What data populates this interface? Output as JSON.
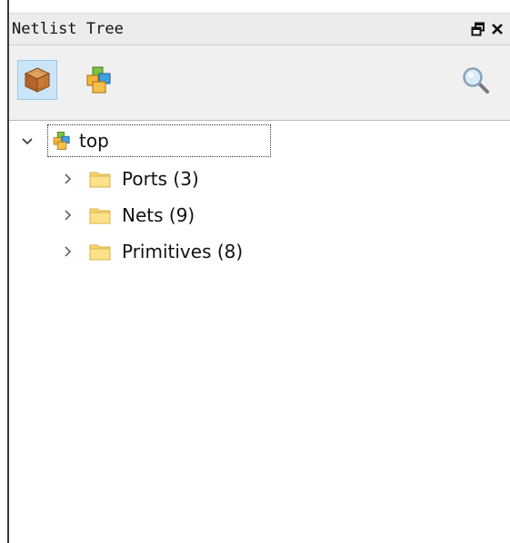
{
  "panel": {
    "title": "Netlist Tree"
  },
  "toolbar": {
    "buttons": [
      {
        "name": "hierarchy-view",
        "icon": "package-cube-icon",
        "active": true
      },
      {
        "name": "cells-view",
        "icon": "colored-cubes-icon",
        "active": false
      }
    ],
    "search_icon": "magnifier-icon"
  },
  "tree": {
    "root": {
      "label": "top",
      "expanded": true,
      "icon": "colored-cubes-icon"
    },
    "children": [
      {
        "label": "Ports (3)",
        "icon": "folder-icon"
      },
      {
        "label": "Nets (9)",
        "icon": "folder-icon"
      },
      {
        "label": "Primitives (8)",
        "icon": "folder-icon"
      }
    ]
  },
  "colors": {
    "active_button": "#cce4f7",
    "folder": "#f7d76b",
    "titlebar": "#ececec"
  }
}
